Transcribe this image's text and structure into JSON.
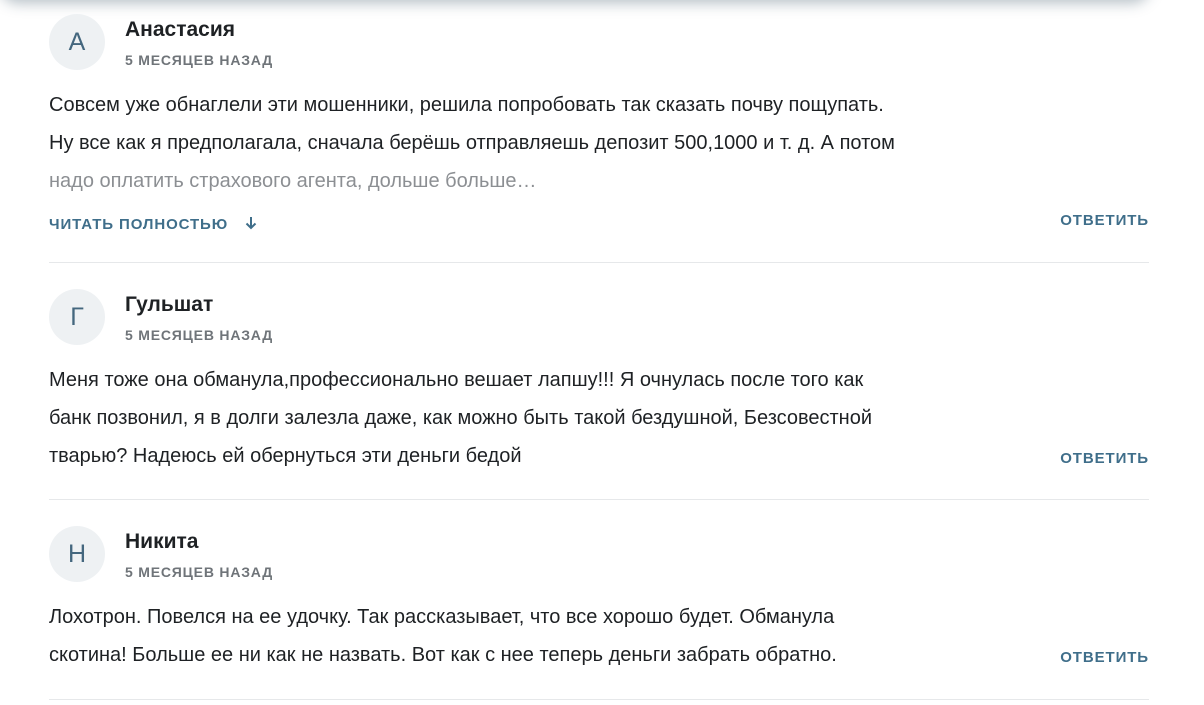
{
  "comments": [
    {
      "initial": "А",
      "author": "Анастасия",
      "date": "5 МЕСЯЦЕВ НАЗАД",
      "lines": [
        "Совсем уже обнаглели эти мошенники, решила попробовать так сказать почву пощупать.",
        "Ну все как я предполагала, сначала берёшь отправляешь депозит 500,1000 и т. д. А потом",
        "надо оплатить страхового агента, дольше больше…"
      ],
      "read_more": "ЧИТАТЬ ПОЛНОСТЬЮ",
      "reply": "ОТВЕТИТЬ"
    },
    {
      "initial": "Г",
      "author": "Гульшат",
      "date": "5 МЕСЯЦЕВ НАЗАД",
      "lines": [
        "Меня тоже она обманула,профессионально вешает лапшу!!! Я очнулась после того как",
        "банк позвонил, я в долги залезла даже, как можно быть такой бездушной, Безсовестной",
        "тварью? Надеюсь ей обернуться эти деньги бедой"
      ],
      "reply": "ОТВЕТИТЬ"
    },
    {
      "initial": "Н",
      "author": "Никита",
      "date": "5 МЕСЯЦЕВ НАЗАД",
      "lines": [
        "Лохотрон. Повелся на ее удочку. Так рассказывает, что все хорошо будет. Обманула",
        "скотина! Больше ее ни как не назвать. Вот как с нее теперь деньги забрать обратно."
      ],
      "reply": "ОТВЕТИТЬ"
    }
  ],
  "icons": {
    "read_more_arrow": "arrow-down-icon"
  },
  "colors": {
    "accent": "#3f6e8a",
    "avatar_bg": "#eef1f3",
    "divider": "#e6e8ea"
  }
}
